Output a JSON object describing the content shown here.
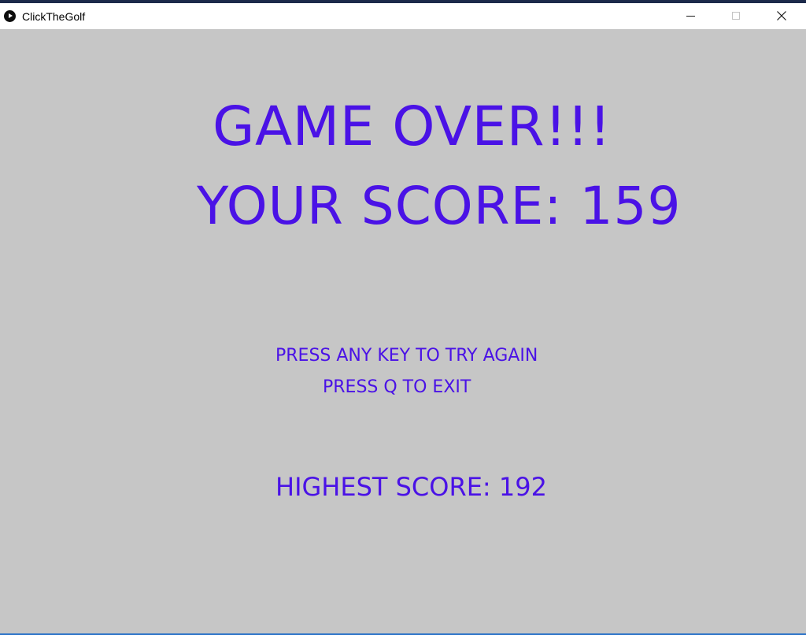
{
  "window": {
    "title": "ClickTheGolf",
    "app_icon": "play-icon",
    "controls": {
      "minimize_icon": "minimize-icon",
      "maximize_icon": "maximize-icon",
      "close_icon": "close-icon"
    }
  },
  "game": {
    "background_color": "#c6c6c6",
    "text_color": "#4a12e6",
    "game_over_text": "GAME OVER!!!",
    "score_text": "YOUR SCORE: 159",
    "score_value": 159,
    "try_again_text": "PRESS ANY KEY TO TRY AGAIN",
    "exit_text": "PRESS Q TO EXIT",
    "highest_score_text": "HIGHEST SCORE: 192",
    "highest_score_value": 192
  }
}
